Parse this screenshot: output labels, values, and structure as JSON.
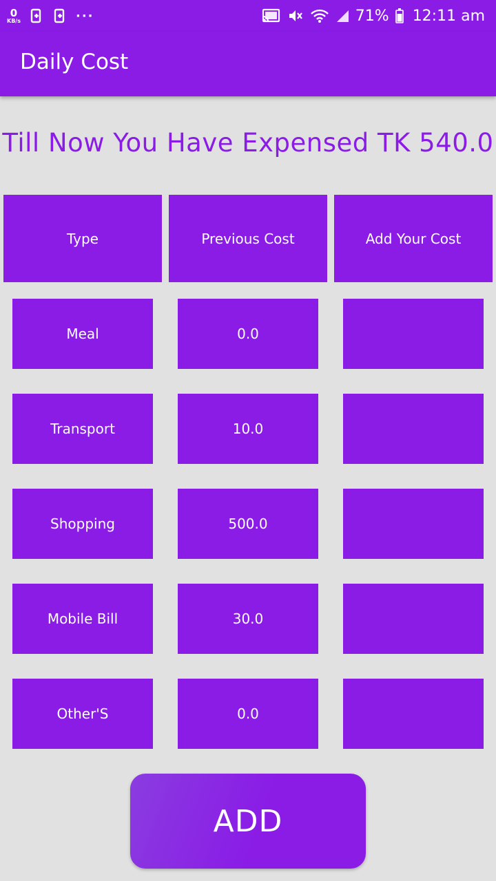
{
  "status_bar": {
    "speed_value": "0",
    "speed_unit": "KB/s",
    "more_dots": "···",
    "battery_percent": "71%",
    "time": "12:11 am",
    "icons": [
      "app-notification-icon",
      "app-notification-icon",
      "cast-icon",
      "mute-icon",
      "wifi-icon",
      "signal-icon",
      "battery-icon"
    ]
  },
  "app_bar": {
    "title": "Daily Cost"
  },
  "summary": {
    "headline": "Till Now You Have Expensed TK 540.0"
  },
  "table": {
    "headers": [
      "Type",
      "Previous Cost",
      "Add Your Cost"
    ],
    "rows": [
      {
        "type": "Meal",
        "previous_cost": "0.0",
        "add_cost": ""
      },
      {
        "type": "Transport",
        "previous_cost": "10.0",
        "add_cost": ""
      },
      {
        "type": "Shopping",
        "previous_cost": "500.0",
        "add_cost": ""
      },
      {
        "type": "Mobile Bill",
        "previous_cost": "30.0",
        "add_cost": ""
      },
      {
        "type": "Other'S",
        "previous_cost": "0.0",
        "add_cost": ""
      }
    ]
  },
  "actions": {
    "add_label": "ADD"
  },
  "colors": {
    "primary": "#8a1ce6",
    "background": "#e1e1e1",
    "text_on_primary": "#ffffff"
  }
}
